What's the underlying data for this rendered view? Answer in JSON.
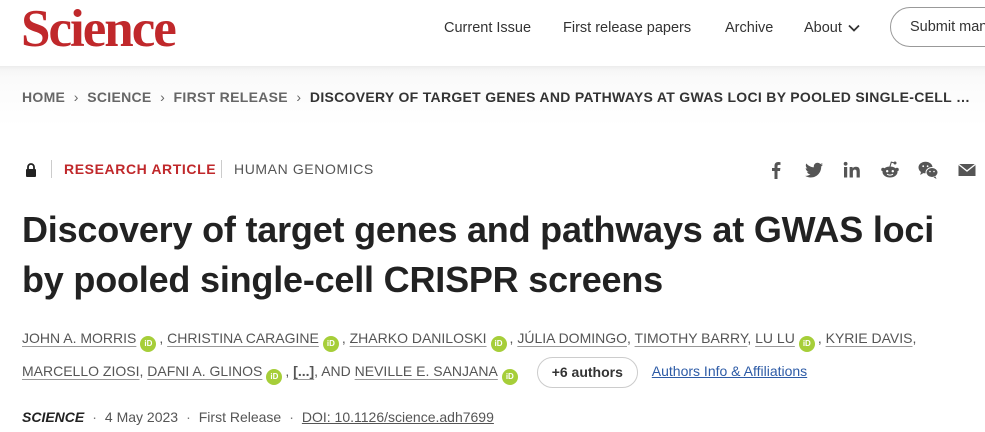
{
  "header": {
    "logo": "Science",
    "nav": [
      "Current Issue",
      "First release papers",
      "Archive",
      "About"
    ],
    "submit_label": "Submit manuscript"
  },
  "breadcrumb": [
    "HOME",
    "SCIENCE",
    "FIRST RELEASE",
    "DISCOVERY OF TARGET GENES AND PATHWAYS AT GWAS LOCI BY POOLED SINGLE-CELL CRISPR SCREENS"
  ],
  "article": {
    "type": "RESEARCH ARTICLE",
    "subject": "HUMAN GENOMICS",
    "title": "Discovery of target genes and pathways at GWAS loci by pooled single-cell CRISPR screens",
    "orcid_badge": "iD",
    "authors": [
      {
        "name": "JOHN A. MORRIS",
        "orcid": true
      },
      {
        "name": "CHRISTINA CARAGINE",
        "orcid": true
      },
      {
        "name": "ZHARKO DANILOSKI",
        "orcid": true
      },
      {
        "name": "JÚLIA DOMINGO",
        "orcid": false
      },
      {
        "name": "TIMOTHY BARRY",
        "orcid": false
      },
      {
        "name": "LU LU",
        "orcid": true
      },
      {
        "name": "KYRIE DAVIS",
        "orcid": false
      },
      {
        "name": "MARCELLO ZIOSI",
        "orcid": false
      },
      {
        "name": "DAFNI A. GLINOS",
        "orcid": true
      },
      {
        "name": "[...]",
        "orcid": false
      },
      {
        "name": "NEVILLE E. SANJANA",
        "orcid": true
      }
    ],
    "and_text": "AND",
    "more_authors_label": "+6 authors",
    "affiliations_label": "Authors Info & Affiliations",
    "journal": "SCIENCE",
    "date": "4 May 2023",
    "release": "First Release",
    "doi": "DOI: 10.1126/science.adh7699"
  },
  "share_icons": [
    "facebook-icon",
    "twitter-icon",
    "linkedin-icon",
    "reddit-icon",
    "wechat-icon",
    "email-icon"
  ],
  "colors": {
    "brand": "#c0282b",
    "link": "#2d5ba6",
    "orcid": "#a6ce39"
  }
}
